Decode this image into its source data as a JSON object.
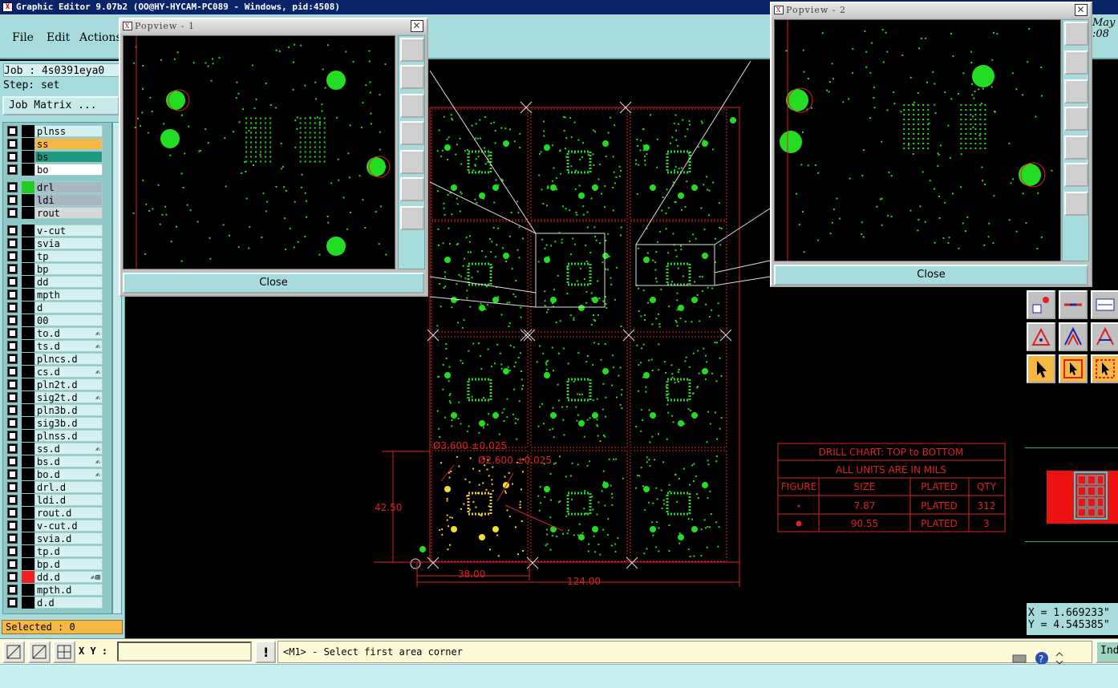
{
  "window": {
    "title": "Graphic Editor 9.07b2 (OO@HY-HYCAM-PC089 - Windows, pid:4508)"
  },
  "menu": [
    {
      "label": "File"
    },
    {
      "label": "Edit"
    },
    {
      "label": "Actions"
    }
  ],
  "job": {
    "label": "Job : 4s0391eya0",
    "step": "Step: set"
  },
  "job_matrix_button": "Job Matrix ...",
  "layers": [
    {
      "name": "plnss",
      "color": "#d4f0f0",
      "swatch": "#000000"
    },
    {
      "name": "ss",
      "color": "#f5b845",
      "swatch": "#000000"
    },
    {
      "name": "bs",
      "color": "#1f9a80",
      "swatch": "#000000"
    },
    {
      "name": "bo",
      "color": "#ffffff",
      "swatch": "#000000"
    },
    {
      "name": "drl",
      "color": "#a8b8c0",
      "swatch": "#22cc22"
    },
    {
      "name": "ldi",
      "color": "#a8b8c0",
      "swatch": "#000000"
    },
    {
      "name": "rout",
      "color": "#d8d8d8",
      "swatch": "#000000"
    },
    {
      "name": "v-cut",
      "color": "#d4f0f0",
      "swatch": "#000000"
    },
    {
      "name": "svia",
      "color": "#d4f0f0",
      "swatch": "#000000"
    },
    {
      "name": "tp",
      "color": "#d4f0f0",
      "swatch": "#000000"
    },
    {
      "name": "bp",
      "color": "#d4f0f0",
      "swatch": "#000000"
    },
    {
      "name": "dd",
      "color": "#d4f0f0",
      "swatch": "#000000"
    },
    {
      "name": "mpth",
      "color": "#d4f0f0",
      "swatch": "#000000"
    },
    {
      "name": "d",
      "color": "#d4f0f0",
      "swatch": "#000000"
    },
    {
      "name": "00",
      "color": "#d4f0f0",
      "swatch": "#000000"
    },
    {
      "name": "to.d",
      "color": "#d4f0f0",
      "swatch": "#000000",
      "mark": "✍"
    },
    {
      "name": "ts.d",
      "color": "#d4f0f0",
      "swatch": "#000000",
      "mark": "✍"
    },
    {
      "name": "plncs.d",
      "color": "#d4f0f0",
      "swatch": "#000000"
    },
    {
      "name": "cs.d",
      "color": "#d4f0f0",
      "swatch": "#000000",
      "mark": "✍"
    },
    {
      "name": "pln2t.d",
      "color": "#d4f0f0",
      "swatch": "#000000"
    },
    {
      "name": "sig2t.d",
      "color": "#d4f0f0",
      "swatch": "#000000",
      "mark": "✍"
    },
    {
      "name": "pln3b.d",
      "color": "#d4f0f0",
      "swatch": "#000000"
    },
    {
      "name": "sig3b.d",
      "color": "#d4f0f0",
      "swatch": "#000000"
    },
    {
      "name": "plnss.d",
      "color": "#d4f0f0",
      "swatch": "#000000"
    },
    {
      "name": "ss.d",
      "color": "#d4f0f0",
      "swatch": "#000000",
      "mark": "✍"
    },
    {
      "name": "bs.d",
      "color": "#d4f0f0",
      "swatch": "#000000",
      "mark": "✍"
    },
    {
      "name": "bo.d",
      "color": "#d4f0f0",
      "swatch": "#000000",
      "mark": "✍"
    },
    {
      "name": "drl.d",
      "color": "#d4f0f0",
      "swatch": "#000000"
    },
    {
      "name": "ldi.d",
      "color": "#d4f0f0",
      "swatch": "#000000"
    },
    {
      "name": "rout.d",
      "color": "#d4f0f0",
      "swatch": "#000000"
    },
    {
      "name": "v-cut.d",
      "color": "#d4f0f0",
      "swatch": "#000000"
    },
    {
      "name": "svia.d",
      "color": "#d4f0f0",
      "swatch": "#000000"
    },
    {
      "name": "tp.d",
      "color": "#d4f0f0",
      "swatch": "#000000"
    },
    {
      "name": "bp.d",
      "color": "#d4f0f0",
      "swatch": "#000000"
    },
    {
      "name": "dd.d",
      "color": "#d4f0f0",
      "swatch": "#ee2222",
      "mark": "✍⊞"
    },
    {
      "name": "mpth.d",
      "color": "#d4f0f0",
      "swatch": "#000000"
    },
    {
      "name": "d.d",
      "color": "#d4f0f0",
      "swatch": "#000000"
    }
  ],
  "selected": "Selected : 0",
  "popview1": {
    "title": "Popview - 1",
    "close": "Close"
  },
  "popview2": {
    "title": "Popview - 2",
    "close": "Close"
  },
  "date_fragment": [
    "May",
    ":08"
  ],
  "drill_chart": {
    "title": "DRILL CHART: TOP to BOTTOM",
    "units": "ALL UNITS ARE IN MILS",
    "headers": [
      "FIGURE",
      "SIZE",
      "PLATED",
      "QTY"
    ],
    "rows": [
      {
        "size": "7.87",
        "plated": "PLATED",
        "qty": "312"
      },
      {
        "size": "90.55",
        "plated": "PLATED",
        "qty": "3"
      }
    ]
  },
  "dimensions": {
    "height": "42.50",
    "pcb_width": "38.00",
    "panel_width": "124.00",
    "hole1": "Ø3.600 ±0.025",
    "hole2": "Ø2.600 ±0.025"
  },
  "coords": {
    "x": "X = 1.669233\"",
    "y": "Y = 4.545385\""
  },
  "status": {
    "xy_label": "X Y :",
    "xy_value": "",
    "message": "<M1> - Select first area corner",
    "ind": "Ind"
  },
  "colors": {
    "pcb_green": "#22dd22",
    "outline_red": "#dd2222",
    "highlight_yellow": "#f5d020",
    "panel_bg": "#a8dcdc"
  }
}
